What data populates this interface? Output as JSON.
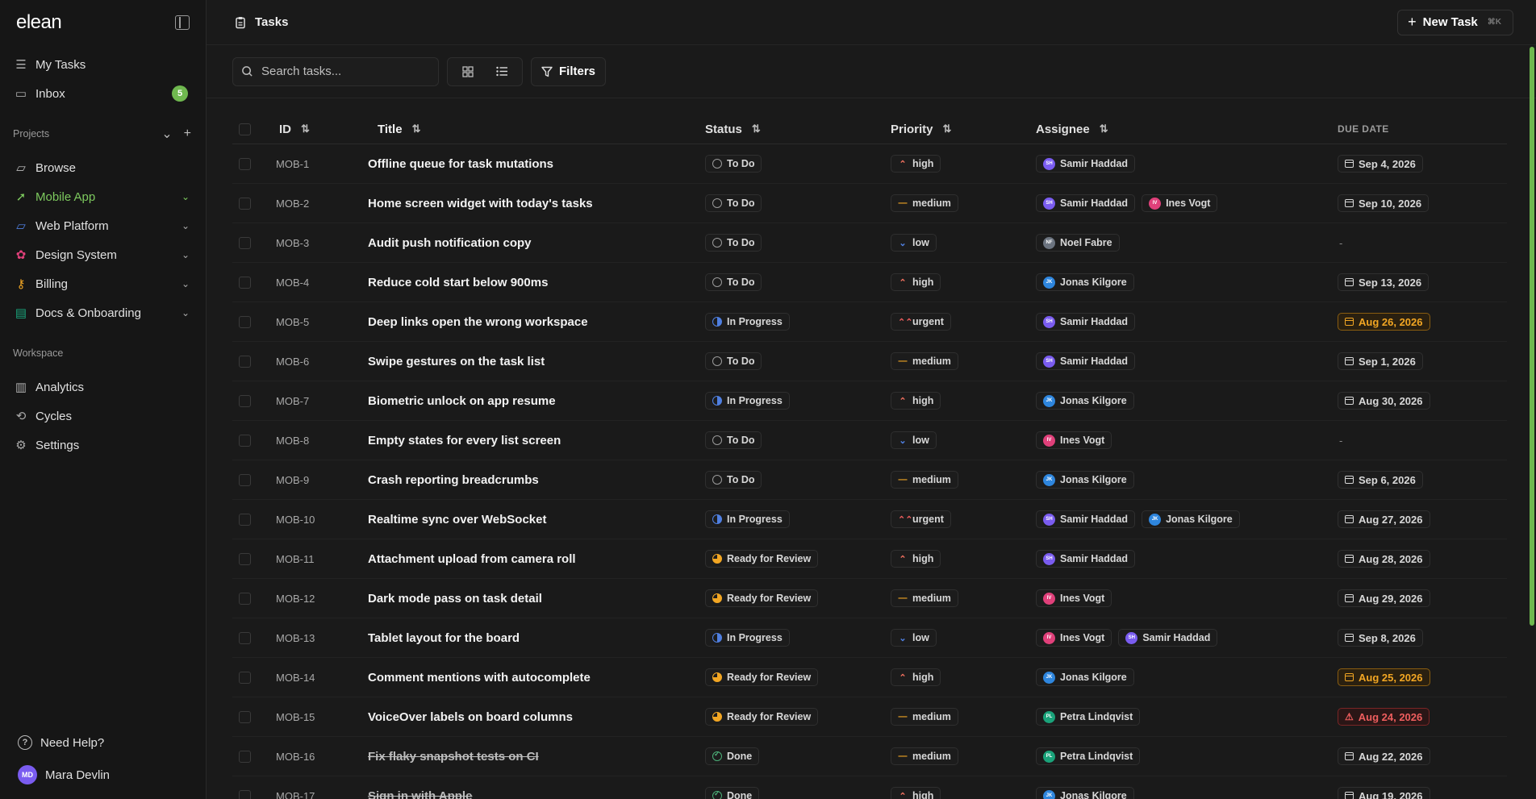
{
  "app": {
    "logo": "elean"
  },
  "sidebar": {
    "top_items": [
      {
        "label": "My Tasks",
        "icon": "stack-icon"
      },
      {
        "label": "Inbox",
        "icon": "inbox-icon",
        "badge": "5"
      }
    ],
    "projects_label": "Projects",
    "projects": [
      {
        "label": "Browse",
        "icon": "folder-icon"
      },
      {
        "label": "Mobile App",
        "icon": "rocket-icon",
        "active": true
      },
      {
        "label": "Web Platform",
        "icon": "folder-icon"
      },
      {
        "label": "Design System",
        "icon": "palette-icon"
      },
      {
        "label": "Billing",
        "icon": "key-icon"
      },
      {
        "label": "Docs & Onboarding",
        "icon": "book-icon"
      }
    ],
    "workspace_label": "Workspace",
    "workspace": [
      {
        "label": "Analytics",
        "icon": "chart-icon"
      },
      {
        "label": "Cycles",
        "icon": "cycle-icon"
      },
      {
        "label": "Settings",
        "icon": "gear-icon"
      }
    ],
    "help_label": "Need Help?",
    "user": {
      "name": "Mara Devlin",
      "initials": "MD"
    }
  },
  "header": {
    "title": "Tasks",
    "new_task_label": "New Task",
    "new_task_shortcut": "⌘K"
  },
  "toolbar": {
    "search_placeholder": "Search tasks...",
    "filters_label": "Filters"
  },
  "table": {
    "columns": {
      "id": "ID",
      "title": "Title",
      "status": "Status",
      "priority": "Priority",
      "assignee": "Assignee",
      "due": "DUE DATE"
    },
    "rows": [
      {
        "id": "MOB-1",
        "title": "Offline queue for task mutations",
        "status": "To Do",
        "priority": "high",
        "assignees": [
          {
            "i": "SH",
            "n": "Samir Haddad",
            "c": "#7a5cf0"
          }
        ],
        "due": "Sep 4, 2026",
        "due_state": "normal"
      },
      {
        "id": "MOB-2",
        "title": "Home screen widget with today's tasks",
        "status": "To Do",
        "priority": "medium",
        "assignees": [
          {
            "i": "SH",
            "n": "Samir Haddad",
            "c": "#7a5cf0"
          },
          {
            "i": "IV",
            "n": "Ines Vogt",
            "c": "#e0407a"
          }
        ],
        "due": "Sep 10, 2026",
        "due_state": "normal"
      },
      {
        "id": "MOB-3",
        "title": "Audit push notification copy",
        "status": "To Do",
        "priority": "low",
        "assignees": [
          {
            "i": "NF",
            "n": "Noel Fabre",
            "c": "#6c7480"
          }
        ],
        "due": "-",
        "due_state": "none"
      },
      {
        "id": "MOB-4",
        "title": "Reduce cold start below 900ms",
        "status": "To Do",
        "priority": "high",
        "assignees": [
          {
            "i": "JK",
            "n": "Jonas Kilgore",
            "c": "#2e86de"
          }
        ],
        "due": "Sep 13, 2026",
        "due_state": "normal"
      },
      {
        "id": "MOB-5",
        "title": "Deep links open the wrong workspace",
        "status": "In Progress",
        "priority": "urgent",
        "assignees": [
          {
            "i": "SH",
            "n": "Samir Haddad",
            "c": "#7a5cf0"
          }
        ],
        "due": "Aug 26, 2026",
        "due_state": "soon"
      },
      {
        "id": "MOB-6",
        "title": "Swipe gestures on the task list",
        "status": "To Do",
        "priority": "medium",
        "assignees": [
          {
            "i": "SH",
            "n": "Samir Haddad",
            "c": "#7a5cf0"
          }
        ],
        "due": "Sep 1, 2026",
        "due_state": "normal"
      },
      {
        "id": "MOB-7",
        "title": "Biometric unlock on app resume",
        "status": "In Progress",
        "priority": "high",
        "assignees": [
          {
            "i": "JK",
            "n": "Jonas Kilgore",
            "c": "#2e86de"
          }
        ],
        "due": "Aug 30, 2026",
        "due_state": "normal"
      },
      {
        "id": "MOB-8",
        "title": "Empty states for every list screen",
        "status": "To Do",
        "priority": "low",
        "assignees": [
          {
            "i": "IV",
            "n": "Ines Vogt",
            "c": "#e0407a"
          }
        ],
        "due": "-",
        "due_state": "none"
      },
      {
        "id": "MOB-9",
        "title": "Crash reporting breadcrumbs",
        "status": "To Do",
        "priority": "medium",
        "assignees": [
          {
            "i": "JK",
            "n": "Jonas Kilgore",
            "c": "#2e86de"
          }
        ],
        "due": "Sep 6, 2026",
        "due_state": "normal"
      },
      {
        "id": "MOB-10",
        "title": "Realtime sync over WebSocket",
        "status": "In Progress",
        "priority": "urgent",
        "assignees": [
          {
            "i": "SH",
            "n": "Samir Haddad",
            "c": "#7a5cf0"
          },
          {
            "i": "JK",
            "n": "Jonas Kilgore",
            "c": "#2e86de"
          }
        ],
        "due": "Aug 27, 2026",
        "due_state": "normal"
      },
      {
        "id": "MOB-11",
        "title": "Attachment upload from camera roll",
        "status": "Ready for Review",
        "priority": "high",
        "assignees": [
          {
            "i": "SH",
            "n": "Samir Haddad",
            "c": "#7a5cf0"
          }
        ],
        "due": "Aug 28, 2026",
        "due_state": "normal"
      },
      {
        "id": "MOB-12",
        "title": "Dark mode pass on task detail",
        "status": "Ready for Review",
        "priority": "medium",
        "assignees": [
          {
            "i": "IV",
            "n": "Ines Vogt",
            "c": "#e0407a"
          }
        ],
        "due": "Aug 29, 2026",
        "due_state": "normal"
      },
      {
        "id": "MOB-13",
        "title": "Tablet layout for the board",
        "status": "In Progress",
        "priority": "low",
        "assignees": [
          {
            "i": "IV",
            "n": "Ines Vogt",
            "c": "#e0407a"
          },
          {
            "i": "SH",
            "n": "Samir Haddad",
            "c": "#7a5cf0"
          }
        ],
        "due": "Sep 8, 2026",
        "due_state": "normal"
      },
      {
        "id": "MOB-14",
        "title": "Comment mentions with autocomplete",
        "status": "Ready for Review",
        "priority": "high",
        "assignees": [
          {
            "i": "JK",
            "n": "Jonas Kilgore",
            "c": "#2e86de"
          }
        ],
        "due": "Aug 25, 2026",
        "due_state": "soon"
      },
      {
        "id": "MOB-15",
        "title": "VoiceOver labels on board columns",
        "status": "Ready for Review",
        "priority": "medium",
        "assignees": [
          {
            "i": "PL",
            "n": "Petra Lindqvist",
            "c": "#1aa37a"
          }
        ],
        "due": "Aug 24, 2026",
        "due_state": "overdue"
      },
      {
        "id": "MOB-16",
        "title": "Fix flaky snapshot tests on CI",
        "status": "Done",
        "priority": "medium",
        "assignees": [
          {
            "i": "PL",
            "n": "Petra Lindqvist",
            "c": "#1aa37a"
          }
        ],
        "due": "Aug 22, 2026",
        "due_state": "normal"
      },
      {
        "id": "MOB-17",
        "title": "Sign in with Apple",
        "status": "Done",
        "priority": "high",
        "assignees": [
          {
            "i": "JK",
            "n": "Jonas Kilgore",
            "c": "#2e86de"
          }
        ],
        "due": "Aug 19, 2026",
        "due_state": "normal"
      }
    ]
  }
}
